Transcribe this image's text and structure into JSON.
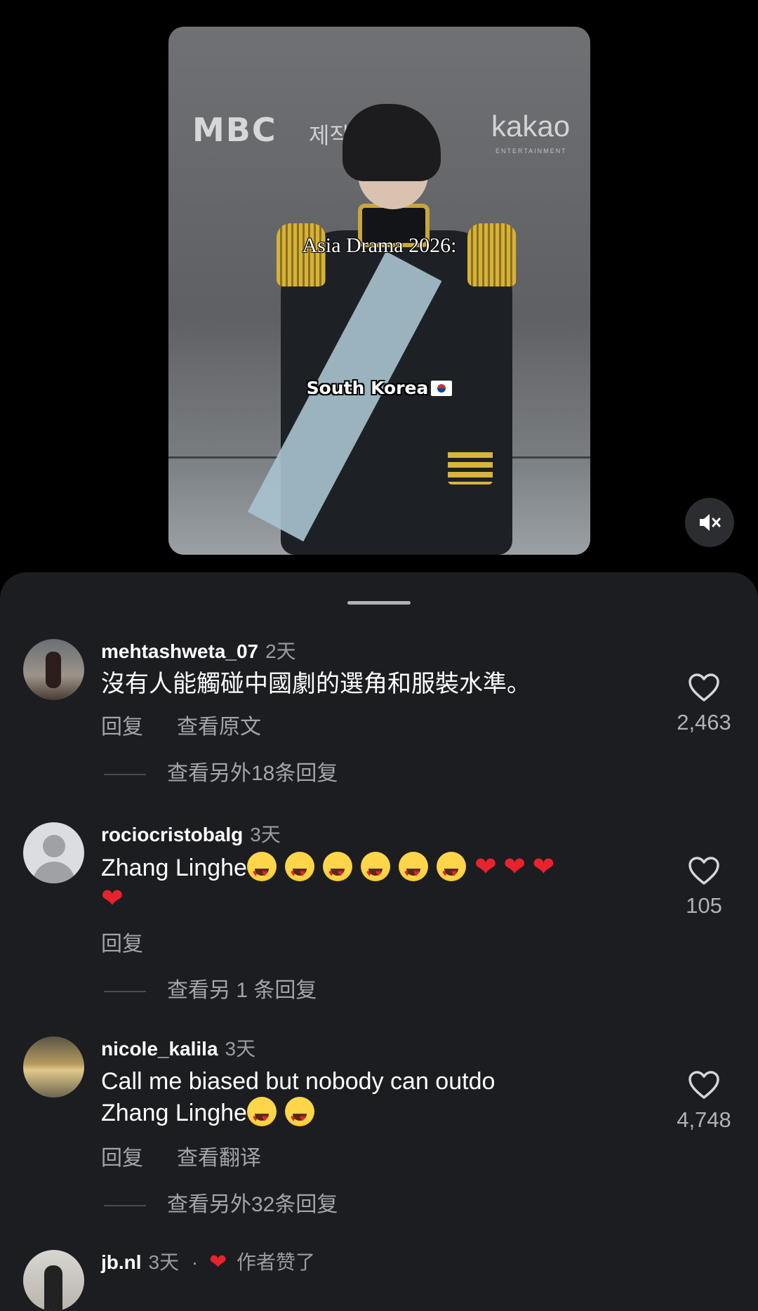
{
  "video": {
    "overlay_title": "Asia Drama 2026:",
    "overlay_country": "South Korea",
    "backdrop_logos": [
      "MBC",
      "제작",
      "kakao",
      "ENTERTAINMENT"
    ],
    "mute_icon": "speaker-muted-icon"
  },
  "comments": [
    {
      "username": "mehtashweta_07",
      "age": "2天",
      "text": "沒有人能觸碰中國劇的選角和服裝水準。",
      "actions": [
        "回复",
        "查看原文"
      ],
      "likes": "2,463",
      "more_replies": "查看另外18条回复"
    },
    {
      "username": "rociocristobalg",
      "age": "3天",
      "text_prefix": "Zhang Linghe",
      "actions": [
        "回复"
      ],
      "likes": "105",
      "more_replies": "查看另 1 条回复"
    },
    {
      "username": "nicole_kalila",
      "age": "3天",
      "text_line1": "Call me biased but nobody can outdo",
      "text_line2": "Zhang Linghe",
      "actions": [
        "回复",
        "查看翻译"
      ],
      "likes": "4,748",
      "more_replies": "查看另外32条回复"
    },
    {
      "username": "jb.nl",
      "age": "3天",
      "separator": "·",
      "author_liked": "作者赞了"
    }
  ],
  "colors": {
    "sheet_bg": "#1b1d20",
    "heart_red": "#e8232e",
    "secondary_text": "#a3a5a9"
  }
}
